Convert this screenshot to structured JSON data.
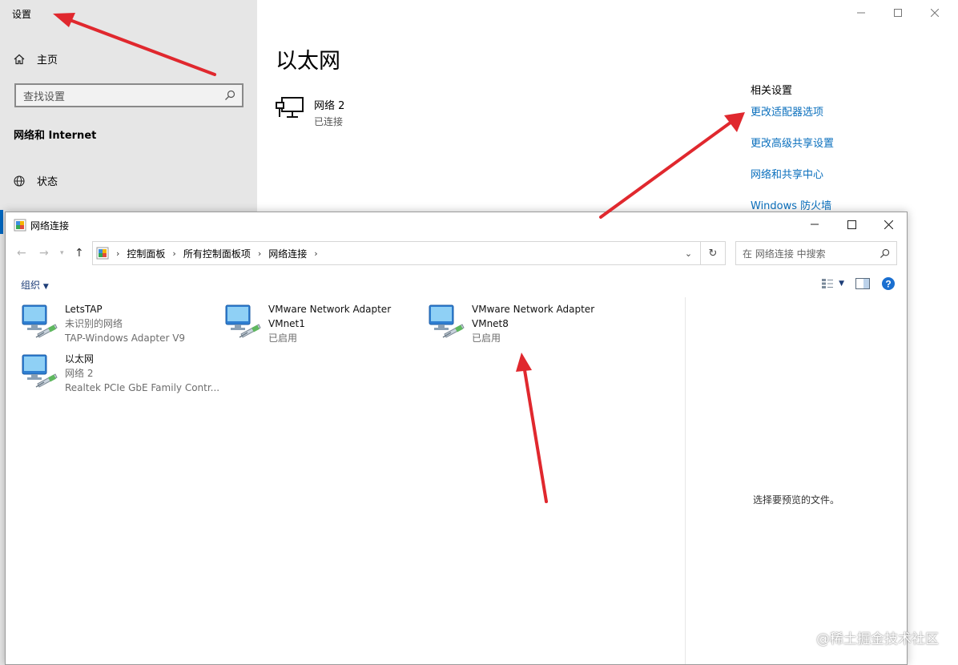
{
  "settings": {
    "title": "设置",
    "home_label": "主页",
    "search_placeholder": "查找设置",
    "section_heading": "网络和 Internet",
    "status_label": "状态",
    "page_title": "以太网",
    "network": {
      "name": "网络 2",
      "status": "已连接"
    },
    "related": {
      "heading": "相关设置",
      "links": [
        "更改适配器选项",
        "更改高级共享设置",
        "网络和共享中心",
        "Windows 防火墙"
      ]
    }
  },
  "explorer": {
    "title": "网络连接",
    "breadcrumb": [
      "控制面板",
      "所有控制面板项",
      "网络连接"
    ],
    "search_placeholder": "在 网络连接 中搜索",
    "organize_label": "组织",
    "preview_message": "选择要预览的文件。",
    "connections": [
      {
        "name": "LetsTAP",
        "status": "未识别的网络",
        "device": "TAP-Windows Adapter V9"
      },
      {
        "name": "VMware Network Adapter VMnet1",
        "status": "已启用"
      },
      {
        "name": "VMware Network Adapter VMnet8",
        "status": "已启用"
      },
      {
        "name": "以太网",
        "status": "网络 2",
        "device": "Realtek PCIe GbE Family Contr..."
      }
    ]
  },
  "colors": {
    "link": "#0a6fbd",
    "sidebar_bg": "#e6e6e6",
    "annotation_arrow": "#e0282e",
    "accent": "#0067c0"
  },
  "watermark": "@稀土掘金技术社区"
}
